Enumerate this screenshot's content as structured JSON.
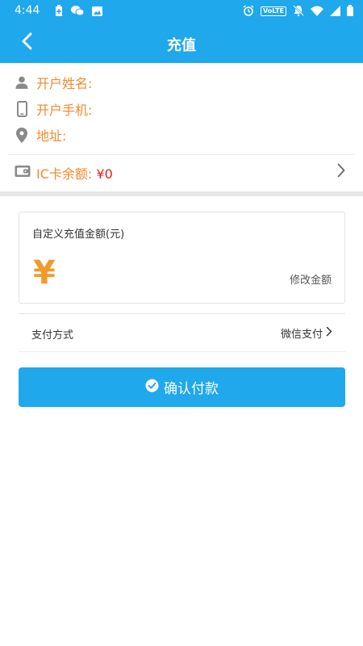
{
  "status_bar": {
    "time": "4:44",
    "left_icons": [
      "battery-saver-icon",
      "wechat-icon",
      "image-icon"
    ],
    "right_icons": [
      "alarm-icon",
      "volte-icon",
      "notifications-off-icon",
      "wifi-icon",
      "signal-icon",
      "battery-icon"
    ],
    "volte_label": "VoLTE"
  },
  "app_bar": {
    "title": "充值",
    "back_icon": "back-arrow-icon"
  },
  "account_info": {
    "name_label": "开户姓名:",
    "phone_label": "开户手机:",
    "address_label": "地址:"
  },
  "balance": {
    "label": "IC卡余额:",
    "value": "¥0"
  },
  "amount_card": {
    "title": "自定义充值金额(元)",
    "currency_symbol": "¥",
    "modify_label": "修改金额"
  },
  "payment": {
    "label": "支付方式",
    "method": "微信支付"
  },
  "confirm": {
    "label": "确认付款"
  },
  "colors": {
    "primary": "#1fa8ec",
    "label_orange": "#f28a2e",
    "balance_red": "#e8201a",
    "yen_orange": "#f09a2c"
  }
}
